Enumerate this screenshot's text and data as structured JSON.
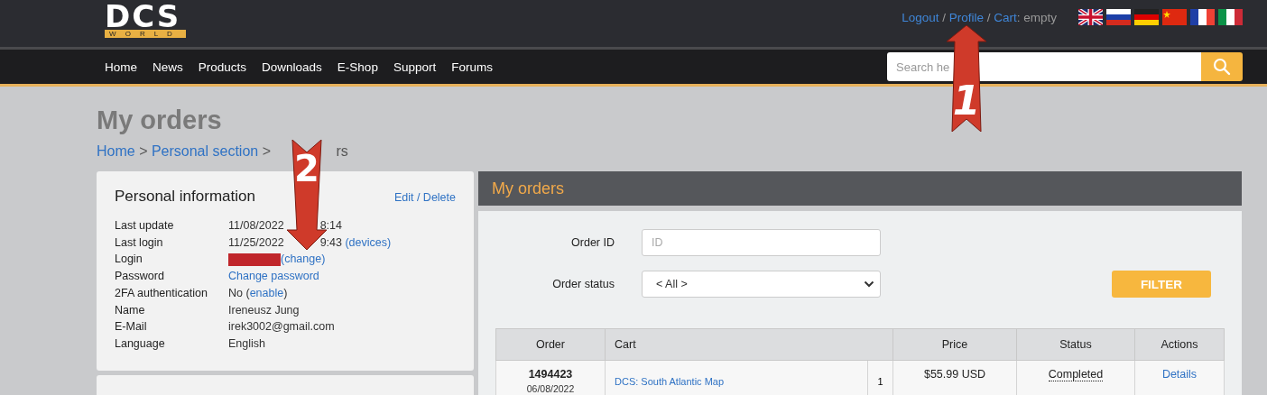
{
  "logo": {
    "text": "DCS",
    "subtitle": "WORLD"
  },
  "account_links": [
    {
      "kind": "link",
      "text": "Logout"
    },
    {
      "kind": "text",
      "text": " / "
    },
    {
      "kind": "link",
      "text": "Profile"
    },
    {
      "kind": "text",
      "text": " / "
    },
    {
      "kind": "link",
      "text": "Cart"
    },
    {
      "kind": "text",
      "text": ": empty"
    }
  ],
  "languages": [
    {
      "kind": "uk"
    },
    {
      "kind": "ru"
    },
    {
      "kind": "de"
    },
    {
      "kind": "cn"
    },
    {
      "kind": "fr"
    },
    {
      "kind": "it"
    }
  ],
  "nav": [
    "Home",
    "News",
    "Products",
    "Downloads",
    "E-Shop",
    "Support",
    "Forums"
  ],
  "search": {
    "placeholder": "Search he"
  },
  "page_title": "My orders",
  "breadcrumb": [
    {
      "kind": "link",
      "text": "Home"
    },
    {
      "kind": "text",
      "text": " > "
    },
    {
      "kind": "link",
      "text": "Personal section"
    },
    {
      "kind": "text",
      "text": " > "
    },
    {
      "kind": "covered"
    },
    {
      "kind": "text",
      "text": "rs"
    }
  ],
  "personal_info": {
    "title": "Personal information",
    "action": "Edit / Delete",
    "rows": [
      {
        "label": "Last update",
        "value": [
          {
            "kind": "text",
            "text": "11/08/2022"
          },
          {
            "kind": "covered"
          },
          {
            "kind": "text",
            "text": "8:14"
          }
        ]
      },
      {
        "label": "Last login",
        "value": [
          {
            "kind": "text",
            "text": "11/25/2022"
          },
          {
            "kind": "covered"
          },
          {
            "kind": "text",
            "text": "9:43 "
          },
          {
            "kind": "link",
            "text": "(devices)"
          }
        ]
      },
      {
        "label": "Login",
        "value": [
          {
            "kind": "redacted"
          },
          {
            "kind": "link",
            "text": "(change)"
          }
        ]
      },
      {
        "label": "Password",
        "value": [
          {
            "kind": "link",
            "text": "Change password"
          }
        ]
      },
      {
        "label": "2FA authentication",
        "value": [
          {
            "kind": "text",
            "text": "No ("
          },
          {
            "kind": "link",
            "text": "enable"
          },
          {
            "kind": "text",
            "text": ")"
          }
        ]
      },
      {
        "label": "Name",
        "value": [
          {
            "kind": "text",
            "text": "Ireneusz Jung"
          }
        ]
      },
      {
        "label": "E-Mail",
        "value": [
          {
            "kind": "text",
            "text": "irek3002@gmail.com"
          }
        ]
      },
      {
        "label": "Language",
        "value": [
          {
            "kind": "text",
            "text": "English"
          }
        ]
      }
    ]
  },
  "orders_panel": {
    "title": "My orders",
    "filters": [
      {
        "label": "Order ID",
        "kind": "input",
        "placeholder": "ID"
      },
      {
        "label": "Order status",
        "kind": "select",
        "value": "< All >"
      }
    ],
    "filter_button": "FILTER",
    "table": {
      "columns": [
        "Order",
        "Cart",
        "Price",
        "Status",
        "Actions"
      ],
      "rows": [
        {
          "order": "1494423",
          "date": "06/08/2022",
          "item": "DCS: South Atlantic Map",
          "quantity": "1",
          "price": "$55.99 USD",
          "status": "Completed",
          "action": "Details"
        }
      ]
    }
  },
  "annotations": [
    {
      "kind": "arrow-up",
      "label": "1"
    },
    {
      "kind": "arrow-down",
      "label": "2"
    }
  ]
}
